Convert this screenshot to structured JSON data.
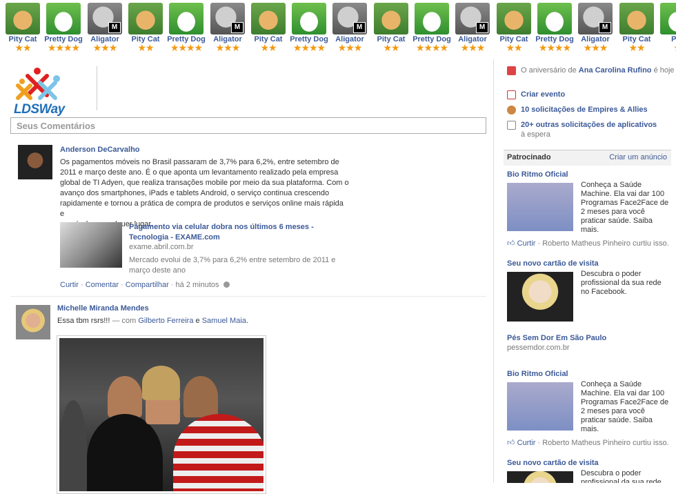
{
  "pets": [
    {
      "name": "Pity Cat",
      "type": "cat",
      "stars": "★★",
      "badge": ""
    },
    {
      "name": "Pretty Dog",
      "type": "dog",
      "stars": "★★★★",
      "badge": ""
    },
    {
      "name": "Aligator",
      "type": "gator",
      "stars": "★★★",
      "badge": "M"
    },
    {
      "name": "Pity Cat",
      "type": "cat",
      "stars": "★★",
      "badge": ""
    },
    {
      "name": "Pretty Dog",
      "type": "dog",
      "stars": "★★★★",
      "badge": ""
    },
    {
      "name": "Aligator",
      "type": "gator",
      "stars": "★★★",
      "badge": "M"
    },
    {
      "name": "Pity Cat",
      "type": "cat",
      "stars": "★★",
      "badge": ""
    },
    {
      "name": "Pretty Dog",
      "type": "dog",
      "stars": "★★★★",
      "badge": ""
    },
    {
      "name": "Aligator",
      "type": "gator",
      "stars": "★★★",
      "badge": "M"
    },
    {
      "name": "Pity Cat",
      "type": "cat",
      "stars": "★★",
      "badge": ""
    },
    {
      "name": "Pretty Dog",
      "type": "dog",
      "stars": "★★★★",
      "badge": ""
    },
    {
      "name": "Aligator",
      "type": "gator",
      "stars": "★★★",
      "badge": "M"
    },
    {
      "name": "Pity Cat",
      "type": "cat",
      "stars": "★★",
      "badge": ""
    },
    {
      "name": "Pretty Dog",
      "type": "dog",
      "stars": "★★★★",
      "badge": ""
    },
    {
      "name": "Aligator",
      "type": "gator",
      "stars": "★★★",
      "badge": "M"
    },
    {
      "name": "Pity Cat",
      "type": "cat",
      "stars": "★★",
      "badge": ""
    },
    {
      "name": "Pre",
      "type": "dog",
      "stars": "★",
      "badge": ""
    }
  ],
  "logo": {
    "text": "LDSWay"
  },
  "comment_box": {
    "placeholder": "Seus Comentários"
  },
  "post1": {
    "author": "Anderson DeCarvalho",
    "lines": [
      "Os pagamentos móveis no Brasil passaram de 3,7% para 6,2%, entre setembro de",
      "2011 e março deste ano. É o que aponta um levantamento realizado pela empresa",
      "global de TI Adyen, que realiza transações mobile por meio da sua plataforma. Com o",
      "avanço dos smartphones, iPads e tablets Android, o serviço continua crescendo",
      "rapidamente e tornou a prática de compra de produtos e serviços online mais rápida e",
      "possível em qualquer lugar."
    ],
    "link_title_1": "Pagamento via celular dobra nos últimos 6 meses -",
    "link_title_2": "Tecnologia - EXAME.com",
    "link_url": "exame.abril.com.br",
    "link_desc": "Mercado evolui de 3,7% para 6,2% entre setembro de 2011 e março deste ano",
    "action_like": "Curtir",
    "action_comment": "Comentar",
    "action_share": "Compartilhar",
    "time": "há 2 minutos"
  },
  "post2": {
    "author": "Michelle Miranda Mendes",
    "text": "Essa tbm rsrs!!!",
    "with": "— com",
    "tag1": "Gilberto Ferreira",
    "and": "e",
    "tag2": "Samuel Maia",
    "dot": "."
  },
  "notifications": {
    "birthday_prefix": "O aniversário de",
    "birthday_name": "Ana Carolina Rufino",
    "birthday_suffix": "é hoje",
    "create_event": "Criar evento",
    "requests_game": "10 solicitações de Empires & Allies",
    "requests_apps": "20+ outras solicitações de aplicativos",
    "waiting": "à espera"
  },
  "sponsored": {
    "header": "Patrocinado",
    "create_ad": "Criar um anúncio",
    "ads": [
      {
        "title": "Bio Ritmo Oficial",
        "desc": "Conheça a Saúde Machine. Ela vai dar 100 Programas Face2Face de 2 meses para você praticar saúde. Saiba mais.",
        "like": "Curtir",
        "liker": "· Roberto Matheus Pinheiro curtiu isso."
      },
      {
        "title": "Seu novo cartão de visita",
        "desc": "Descubra o poder profissional da sua rede no Facebook."
      },
      {
        "title": "Pés Sem Dor Em São Paulo",
        "url": "pessemdor.com.br"
      },
      {
        "title": "Bio Ritmo Oficial",
        "desc": "Conheça a Saúde Machine. Ela vai dar 100 Programas Face2Face de 2 meses para você praticar saúde. Saiba mais.",
        "like": "Curtir",
        "liker": "· Roberto Matheus Pinheiro curtiu isso."
      },
      {
        "title": "Seu novo cartão de visita",
        "desc": "Descubra o poder profissional da sua rede"
      }
    ]
  }
}
